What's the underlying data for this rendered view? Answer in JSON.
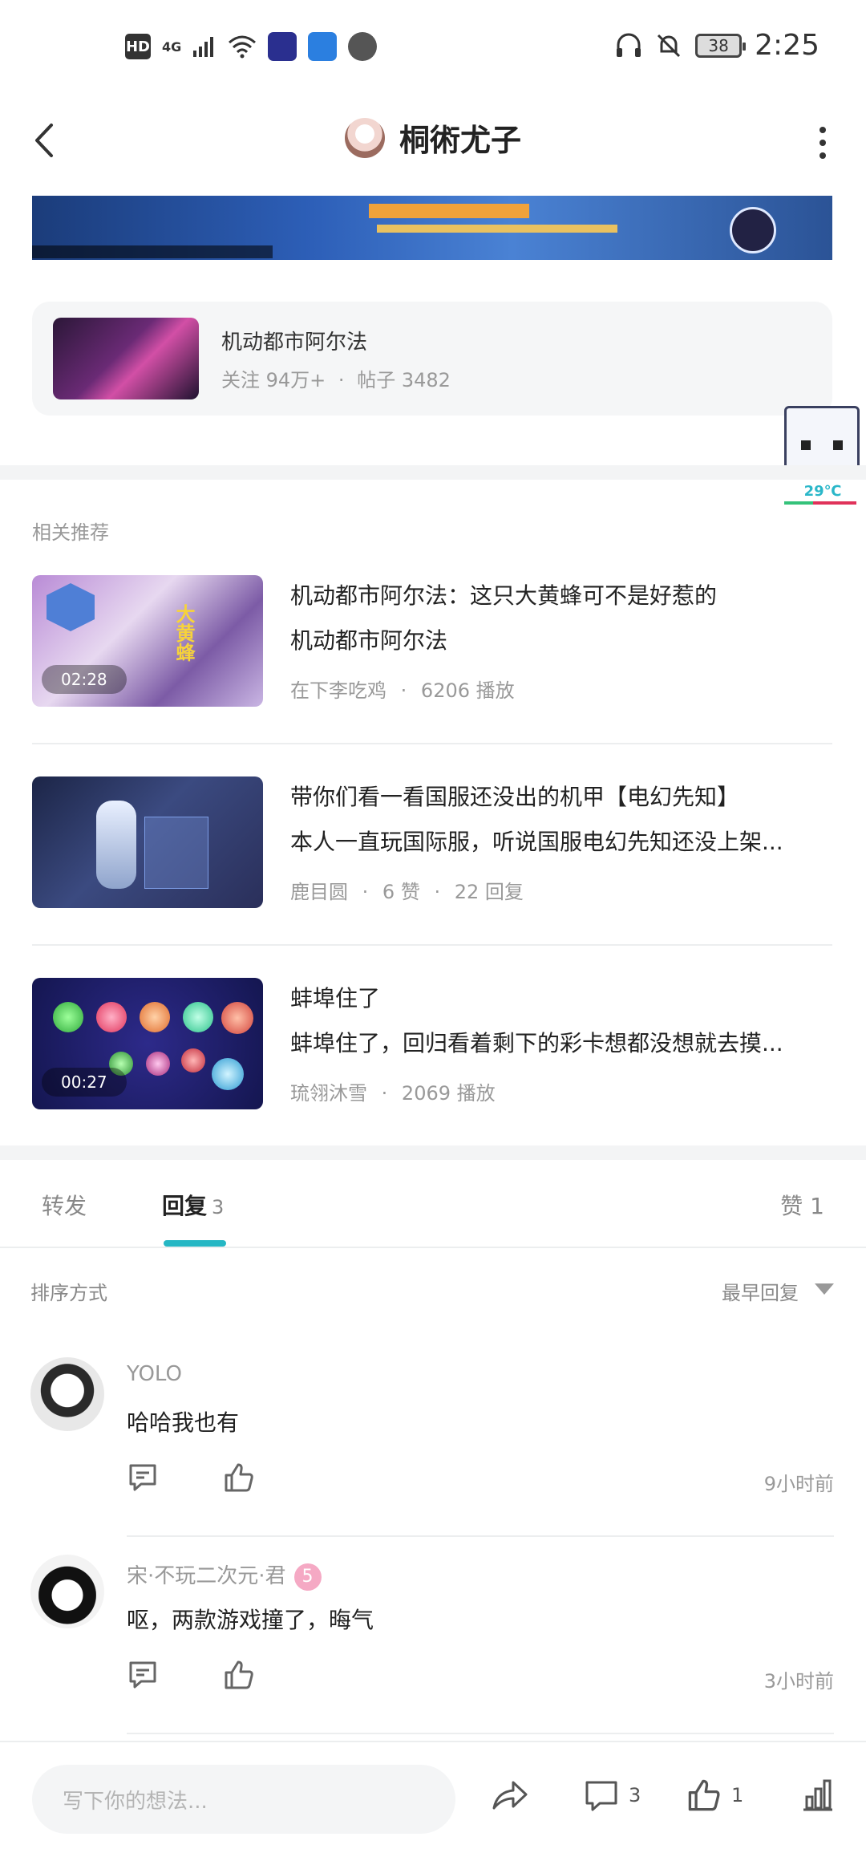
{
  "status_bar": {
    "hd": "HD",
    "network": "4G",
    "battery": "38",
    "time": "2:25"
  },
  "header": {
    "title": "桐術尤子"
  },
  "forum": {
    "name": "机动都市阿尔法",
    "followers": "关注 94万+",
    "posts": "帖子 3482",
    "separator": "·"
  },
  "float_widget": {
    "temperature": "29℃"
  },
  "related": {
    "label": "相关推荐",
    "items": [
      {
        "title": "机动都市阿尔法：这只大黄蜂可不是好惹的",
        "desc": "机动都市阿尔法",
        "author": "在下李吃鸡",
        "stat1": "6206 播放",
        "stat2": "",
        "duration": "02:28",
        "thumb_text": "大黄蜂"
      },
      {
        "title": "带你们看一看国服还没出的机甲【电幻先知】",
        "desc": "本人一直玩国际服，听说国服电幻先知还没上架...",
        "author": "鹿目圆",
        "stat1": "6 赞",
        "stat2": "22 回复",
        "duration": ""
      },
      {
        "title": "蚌埠住了",
        "desc": "蚌埠住了，回归看着剩下的彩卡想都没想就去摸...",
        "author": "琉翎沐雪",
        "stat1": "2069 播放",
        "stat2": "",
        "duration": "00:27"
      }
    ]
  },
  "tabs": {
    "forward": "转发",
    "reply": "回复",
    "reply_count": "3",
    "like": "赞 1"
  },
  "sort": {
    "label": "排序方式",
    "value": "最早回复"
  },
  "comments": [
    {
      "name": "YOLO",
      "text": "哈哈我也有",
      "time": "9小时前"
    },
    {
      "name": "宋·不玩二次元·君",
      "badge": "5",
      "text": "呕，两款游戏撞了，晦气",
      "time": "3小时前"
    }
  ],
  "bottom": {
    "placeholder": "写下你的想法...",
    "comment_count": "3",
    "like_count": "1"
  },
  "colors": {
    "accent": "#25b7c4",
    "muted_text": "#999999",
    "divider": "#eceeef"
  }
}
